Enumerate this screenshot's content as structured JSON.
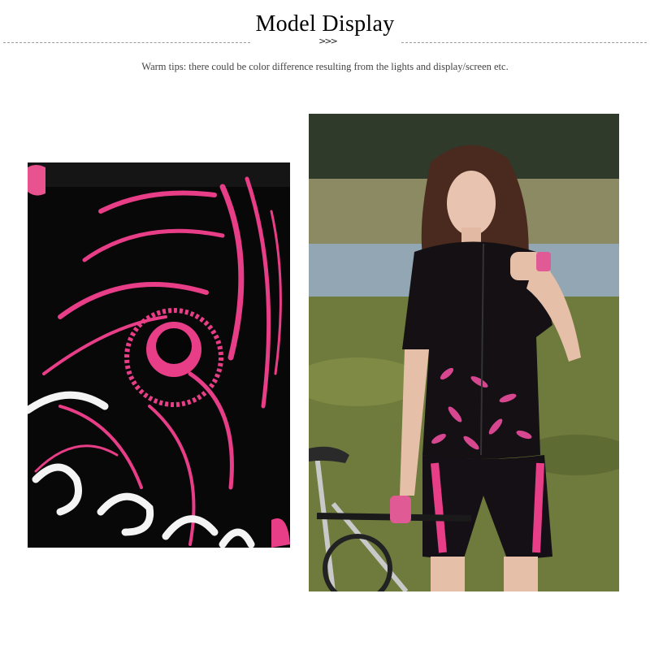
{
  "header": {
    "title": "Model Display",
    "chevron": ">>>",
    "tips": "Warm tips: there could be color difference resulting from the lights and display/screen etc."
  },
  "photos": {
    "left_alt": "Close-up of jersey fabric print",
    "right_alt": "Model wearing cycling jersey and shorts next to road bike"
  },
  "colors": {
    "accent_pink": "#e83d87",
    "fabric_black": "#0a0a0a",
    "grass_green": "#6b7a3a",
    "lake_blue": "#8ea3b3"
  }
}
